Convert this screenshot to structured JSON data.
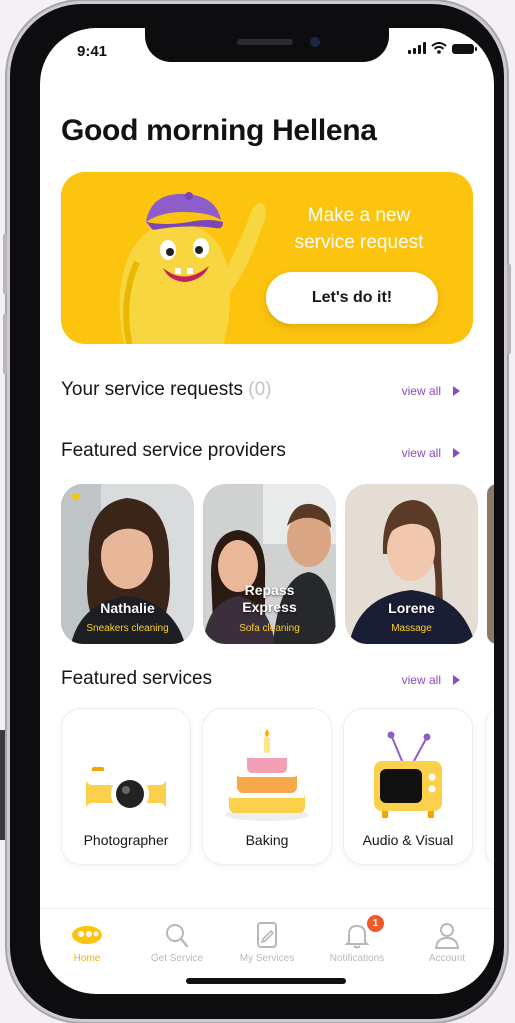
{
  "status": {
    "time": "9:41"
  },
  "greeting": "Good morning Hellena",
  "banner": {
    "line1": "Make a new",
    "line2": "service request",
    "button": "Let's do it!"
  },
  "service_requests": {
    "title": "Your service requests",
    "count": "(0)",
    "view_all": "view all"
  },
  "featured_providers": {
    "title": "Featured service providers",
    "view_all": "view all",
    "items": [
      {
        "name": "Nathalie",
        "service": "Sneakers cleaning"
      },
      {
        "name_line1": "Repass",
        "name_line2": "Express",
        "service": "Sofa cleaning"
      },
      {
        "name": "Lorene",
        "service": "Massage"
      }
    ]
  },
  "featured_services": {
    "title": "Featured services",
    "view_all": "view all",
    "items": [
      {
        "label": "Photographer"
      },
      {
        "label": "Baking"
      },
      {
        "label": "Audio & Visual"
      }
    ]
  },
  "tabbar": {
    "items": [
      {
        "label": "Home",
        "icon": "home-logo-icon"
      },
      {
        "label": "Get Service",
        "icon": "search-icon"
      },
      {
        "label": "My Services",
        "icon": "document-edit-icon"
      },
      {
        "label": "Notifications",
        "icon": "bell-icon",
        "badge": "1"
      },
      {
        "label": "Account",
        "icon": "user-icon"
      }
    ]
  },
  "colors": {
    "brand_yellow": "#fcc40f",
    "accent_purple": "#8a4bc6",
    "badge_orange": "#f05a28"
  }
}
